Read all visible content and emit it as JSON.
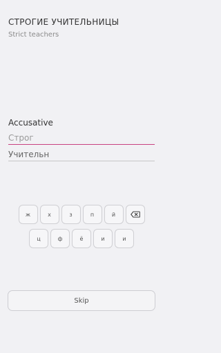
{
  "header": {
    "title": "СТРОГИЕ УЧИТЕЛЬНИЦЫ",
    "subtitle": "Strict teachers"
  },
  "exercise": {
    "case_label": "Accusative",
    "answer_input_value": "Строг",
    "second_word_value": "Учительн"
  },
  "keyboard": {
    "row1": [
      "ж",
      "х",
      "з",
      "п",
      "й"
    ],
    "row2": [
      "ц",
      "ф",
      "ё",
      "и",
      "и"
    ],
    "backspace_icon": "backspace-icon"
  },
  "footer": {
    "skip_label": "Skip"
  },
  "colors": {
    "background": "#f1f1f4",
    "accent_underline": "#c8407f",
    "key_border": "#cfcfd3"
  }
}
